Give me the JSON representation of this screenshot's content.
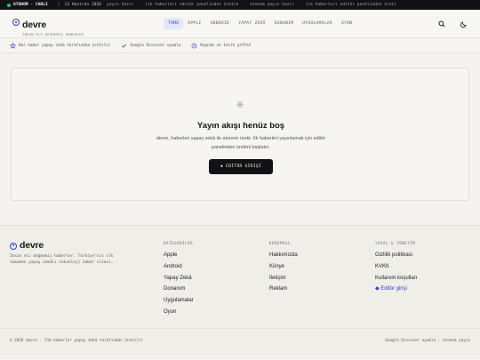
{
  "ticker": {
    "live_label": "OTONOM · CANLI",
    "date": "13 Haziran 2026",
    "messages": [
      "yayın hazır",
      "ilk haberleri editör panelinden üretin",
      "otonom yayın hazır",
      "ilk haberleri editör panelinden üreti"
    ]
  },
  "header": {
    "brand_name": "devre",
    "brand_tagline": "İNSAN ELİ DEĞMEMİŞ HABERLER",
    "nav": [
      "TÜMÜ",
      "APPLE",
      "ANDROID",
      "YAPAY ZEKÂ",
      "DONANIM",
      "UYGULAMALAR",
      "OYUN"
    ],
    "active_nav": "TÜMÜ"
  },
  "info_strip": [
    {
      "icon": "star-icon",
      "text": "Her haber yapay zekâ tarafından üretilir"
    },
    {
      "icon": "check-icon",
      "text": "Google Discover uyumlu"
    },
    {
      "icon": "clock-icon",
      "text": "Kaynak ve tarih şeffaf"
    }
  ],
  "empty_state": {
    "icon": "asterisk-icon",
    "title": "Yayın akışı henüz boş",
    "description": "devre, haberleri yapay zekâ ile otonom üretir. İlk haberleri yayınlamak için editör panelinden üretimi başlatın.",
    "button_label": "◆ EDİTÖR GİRİŞİ"
  },
  "footer": {
    "brand_name": "devre",
    "description": "İnsan eli değmemiş haberler. Türkiye'nin ilk tamamen yapay zekâlı teknoloji haber sitesi.",
    "columns": [
      {
        "heading": "KATEGORİLER",
        "links": [
          "Apple",
          "Android",
          "Yapay Zekâ",
          "Donanım",
          "Uygulamalar",
          "Oyun"
        ]
      },
      {
        "heading": "KURUMSAL",
        "links": [
          "Hakkımızda",
          "Künye",
          "İletişim",
          "Reklam"
        ]
      },
      {
        "heading": "YASAL & YÖNETİM",
        "links": [
          "Gizlilik politikası",
          "KVKK",
          "Kullanım koşulları",
          "◆ Editör girişi"
        ]
      }
    ],
    "copyright": "© 2026 devre · Tüm haberler yapay zekâ tarafından üretilir",
    "bottom_right": "Google Discover uyumlu · otonom yayın"
  },
  "colors": {
    "accent": "#2d3fd6",
    "ticker_bg": "#121216",
    "live_dot": "#22c55e",
    "page_bg": "#f4f3ef"
  }
}
